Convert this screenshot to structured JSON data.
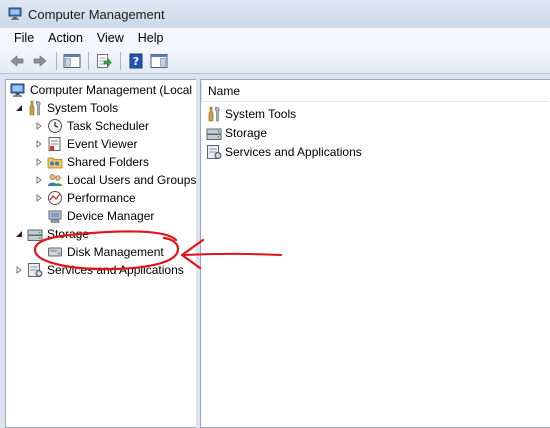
{
  "window": {
    "title": "Computer Management"
  },
  "menubar": {
    "items": [
      "File",
      "Action",
      "View",
      "Help"
    ]
  },
  "toolbar": {
    "buttons": [
      "back-arrow-icon",
      "forward-arrow-icon",
      "show-hide-console-tree-icon",
      "export-list-icon",
      "help-icon",
      "show-hide-action-pane-icon"
    ]
  },
  "tree": {
    "root": "Computer Management (Local",
    "system_tools": "System Tools",
    "task_scheduler": "Task Scheduler",
    "event_viewer": "Event Viewer",
    "shared_folders": "Shared Folders",
    "local_users": "Local Users and Groups",
    "performance": "Performance",
    "device_manager": "Device Manager",
    "storage": "Storage",
    "disk_management": "Disk Management",
    "services": "Services and Applications"
  },
  "list": {
    "column_name": "Name",
    "rows": [
      "System Tools",
      "Storage",
      "Services and Applications"
    ]
  },
  "annotation": {
    "color": "#e0141a",
    "target": "Disk Management"
  }
}
